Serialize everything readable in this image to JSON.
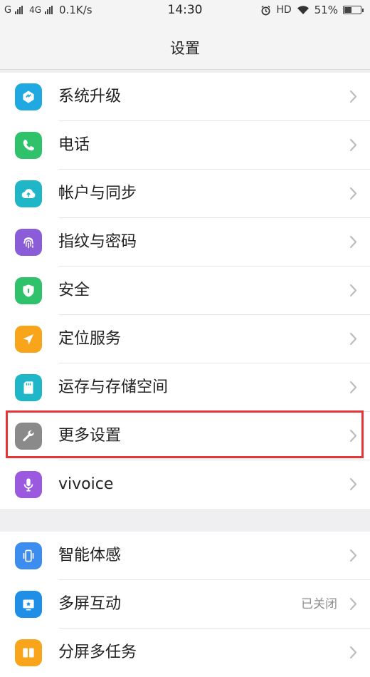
{
  "status_bar": {
    "carrier_label": "G",
    "network_type": "4G",
    "speed": "0.1K/s",
    "time": "14:30",
    "hd_label": "HD",
    "battery_percent": "51%",
    "battery_level": 0.51
  },
  "header": {
    "title": "设置"
  },
  "settings_group_1": [
    {
      "label": "系统升级",
      "icon": "system-update-icon",
      "color": "#20a9e1"
    },
    {
      "label": "电话",
      "icon": "phone-icon",
      "color": "#2fc26a"
    },
    {
      "label": "帐户与同步",
      "icon": "cloud-sync-icon",
      "color": "#1fb7c8"
    },
    {
      "label": "指纹与密码",
      "icon": "fingerprint-icon",
      "color": "#8b5cd8"
    },
    {
      "label": "安全",
      "icon": "shield-icon",
      "color": "#2fc26a"
    },
    {
      "label": "定位服务",
      "icon": "location-arrow-icon",
      "color": "#f8a51c"
    },
    {
      "label": "运存与存储空间",
      "icon": "sd-card-icon",
      "color": "#1fb7c8"
    },
    {
      "label": "更多设置",
      "icon": "wrench-icon",
      "color": "#8a8a8a"
    },
    {
      "label": "vivoice",
      "icon": "microphone-icon",
      "color": "#9b59e0"
    }
  ],
  "settings_group_2": [
    {
      "label": "智能体感",
      "icon": "phone-motion-icon",
      "color": "#3d8cf0",
      "value": ""
    },
    {
      "label": "多屏互动",
      "icon": "multi-screen-icon",
      "color": "#1e8ee6",
      "value": "已关闭"
    },
    {
      "label": "分屏多任务",
      "icon": "split-screen-icon",
      "color": "#f8a51c",
      "value": ""
    }
  ],
  "highlighted_item": "更多设置"
}
